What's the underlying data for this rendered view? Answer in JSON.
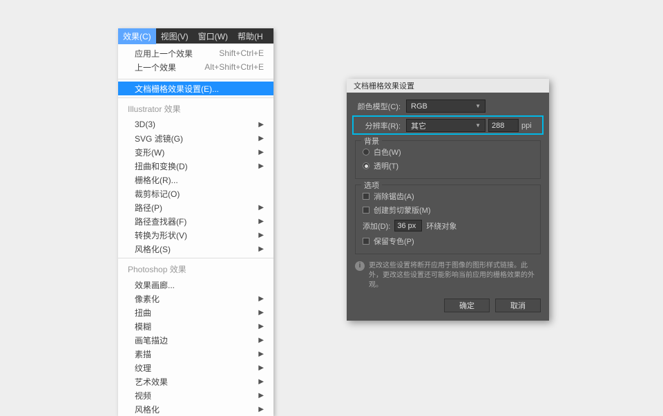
{
  "menubar": {
    "items": [
      "效果(C)",
      "视图(V)",
      "窗口(W)",
      "帮助(H"
    ]
  },
  "menu": {
    "top": [
      {
        "label": "应用上一个效果",
        "shortcut": "Shift+Ctrl+E"
      },
      {
        "label": "上一个效果",
        "shortcut": "Alt+Shift+Ctrl+E"
      }
    ],
    "highlighted": "文档栅格效果设置(E)...",
    "group1_header": "Illustrator 效果",
    "group1": [
      {
        "label": "3D(3)",
        "arrow": true
      },
      {
        "label": "SVG 滤镜(G)",
        "arrow": true
      },
      {
        "label": "变形(W)",
        "arrow": true
      },
      {
        "label": "扭曲和变换(D)",
        "arrow": true
      },
      {
        "label": "栅格化(R)...",
        "arrow": false
      },
      {
        "label": "裁剪标记(O)",
        "arrow": false
      },
      {
        "label": "路径(P)",
        "arrow": true
      },
      {
        "label": "路径查找器(F)",
        "arrow": true
      },
      {
        "label": "转换为形状(V)",
        "arrow": true
      },
      {
        "label": "风格化(S)",
        "arrow": true
      }
    ],
    "group2_header": "Photoshop 效果",
    "group2": [
      {
        "label": "效果画廊...",
        "arrow": false
      },
      {
        "label": "像素化",
        "arrow": true
      },
      {
        "label": "扭曲",
        "arrow": true
      },
      {
        "label": "模糊",
        "arrow": true
      },
      {
        "label": "画笔描边",
        "arrow": true
      },
      {
        "label": "素描",
        "arrow": true
      },
      {
        "label": "纹理",
        "arrow": true
      },
      {
        "label": "艺术效果",
        "arrow": true
      },
      {
        "label": "视频",
        "arrow": true
      },
      {
        "label": "风格化",
        "arrow": true
      }
    ]
  },
  "dialog": {
    "title": "文档栅格效果设置",
    "color_model_label": "颜色模型(C):",
    "color_model_value": "RGB",
    "resolution_label": "分辨率(R):",
    "resolution_value": "其它",
    "resolution_input": "288",
    "resolution_unit": "ppi",
    "bg_group": "背景",
    "bg_white": "白色(W)",
    "bg_transparent": "透明(T)",
    "opt_group": "选项",
    "opt_antialias": "消除锯齿(A)",
    "opt_clipmask": "创建剪切蒙版(M)",
    "add_label": "添加(D):",
    "add_value": "36 px",
    "add_suffix": "环绕对象",
    "opt_spot": "保留专色(P)",
    "info_text": "更改这些设置将断开应用于图像的图形样式链接。此外，更改这些设置还可能影响当前应用的栅格效果的外观。",
    "ok": "确定",
    "cancel": "取消"
  }
}
